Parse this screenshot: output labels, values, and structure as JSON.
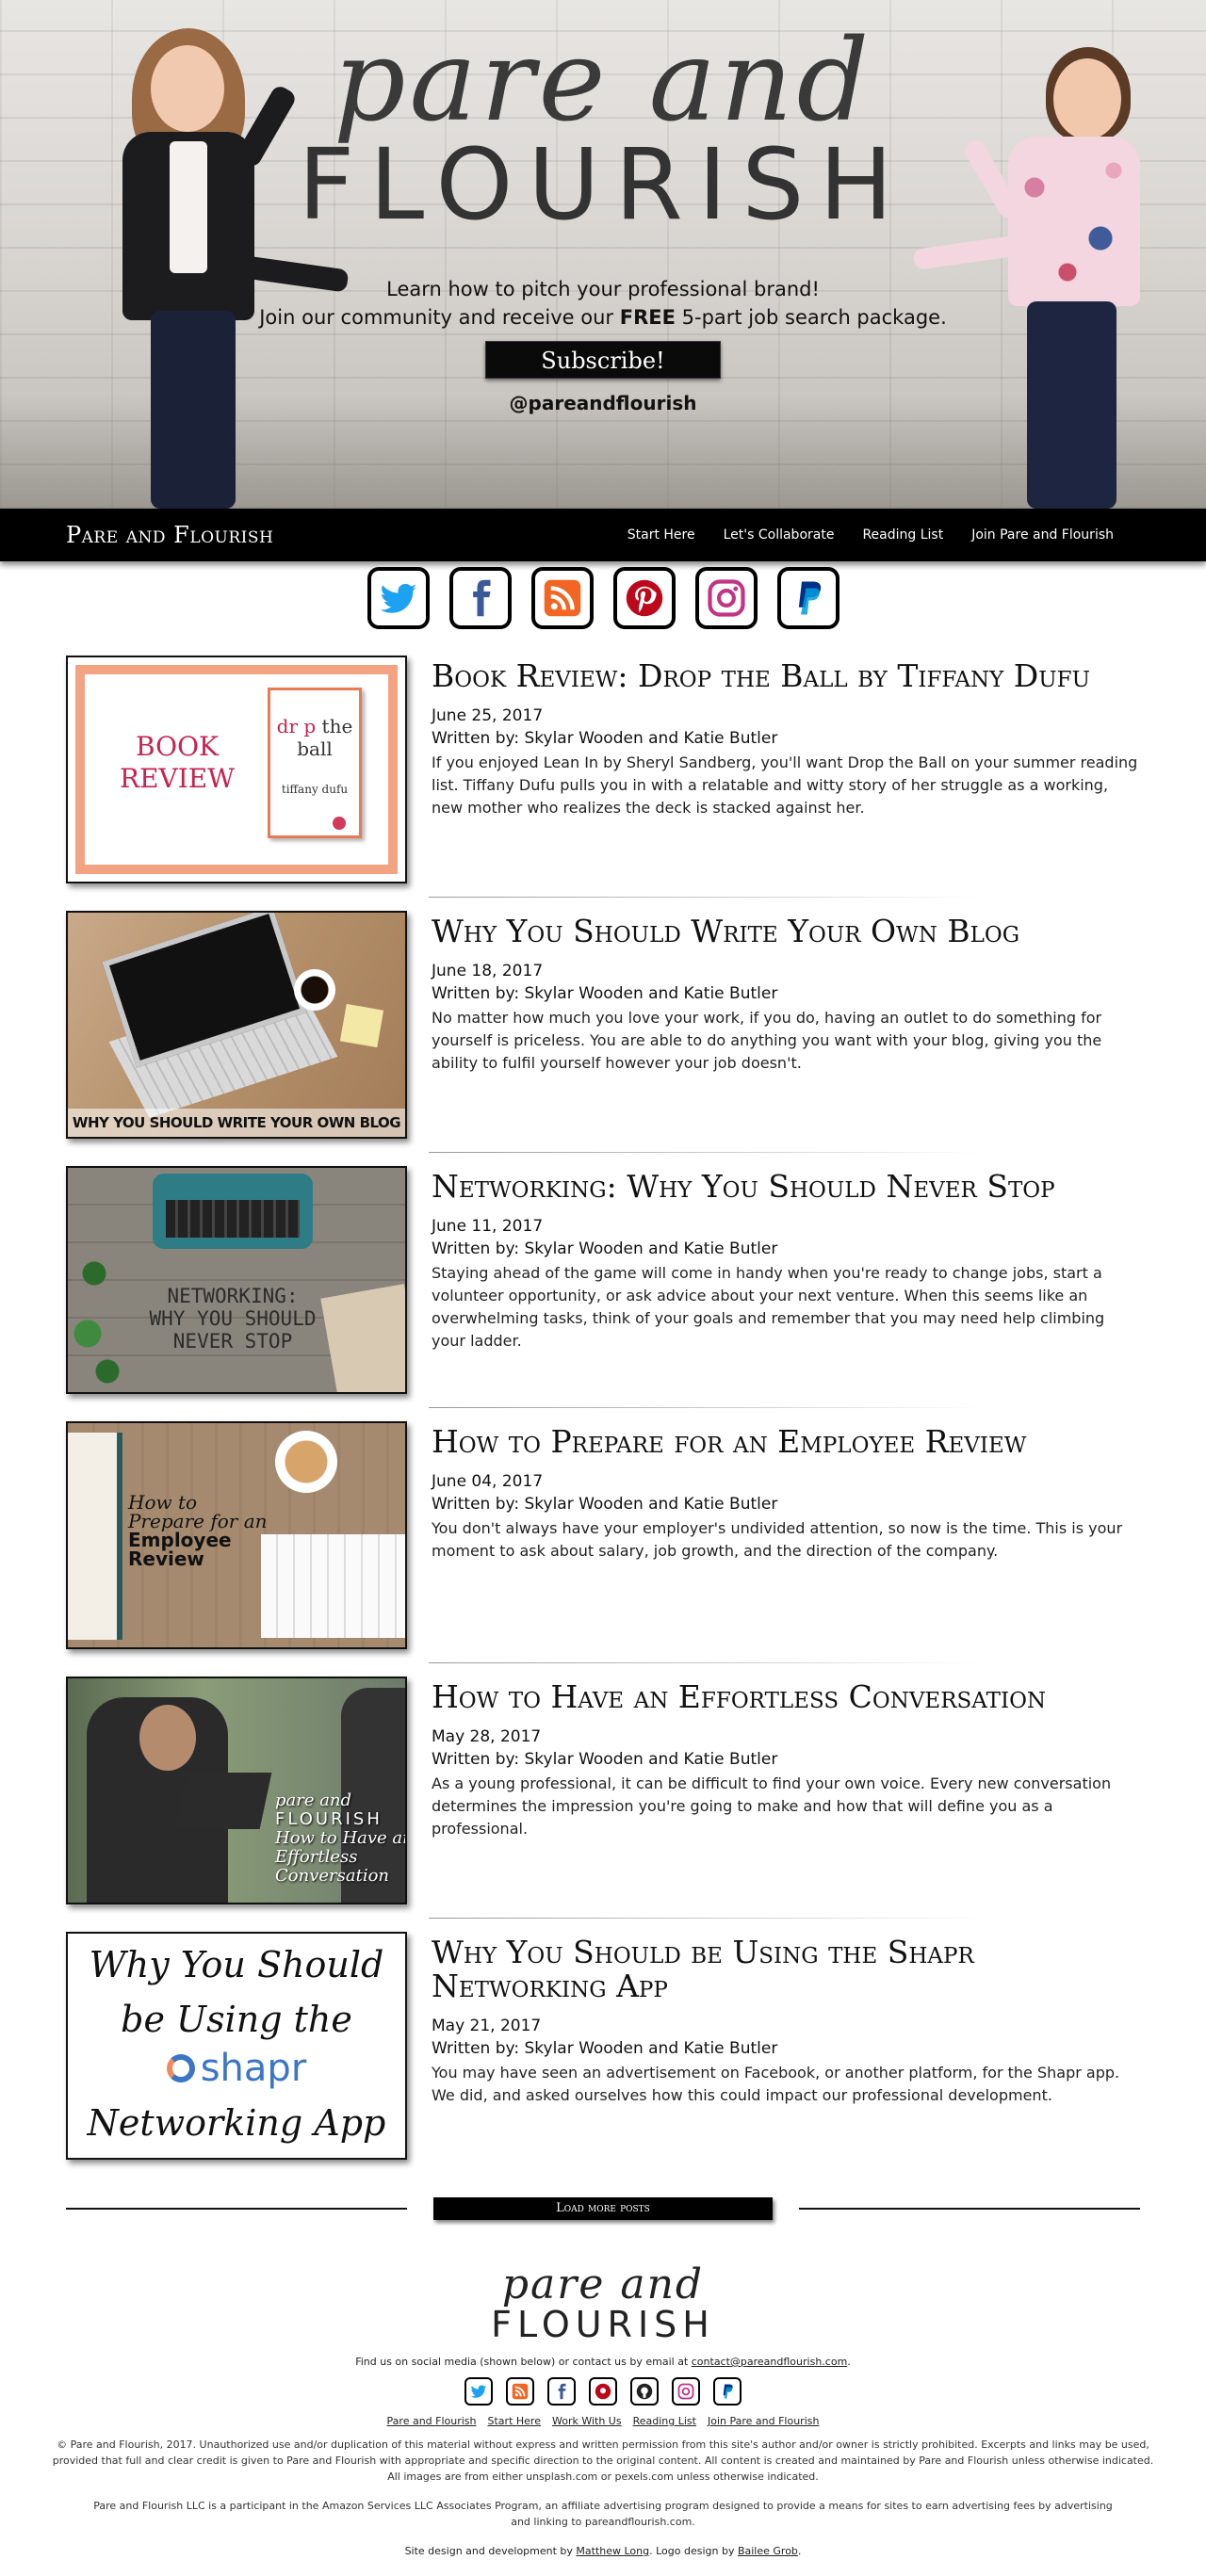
{
  "hero": {
    "script_title": "pare and",
    "main_title": "FLOURISH",
    "tagline_1": "Learn how to pitch your professional brand!",
    "tagline_2a": "Join our community and receive our ",
    "tagline_2b": "FREE",
    "tagline_2c": " 5-part job search package.",
    "subscribe_label": "Subscribe!",
    "handle": "@pareandflourish"
  },
  "nav": {
    "brand": "Pare and Flourish",
    "links": [
      "Start Here",
      "Let's Collaborate",
      "Reading List",
      "Join Pare and Flourish"
    ]
  },
  "social": {
    "icons": [
      "twitter-icon",
      "facebook-icon",
      "rss-icon",
      "pinterest-icon",
      "instagram-icon",
      "paypal-icon"
    ],
    "colors": {
      "twitter": "#1da1f2",
      "facebook": "#3b5998",
      "rss": "#f26522",
      "pinterest": "#bd081c",
      "instagram": "#c13584",
      "paypal": "#009cde",
      "github": "#222222"
    }
  },
  "posts": [
    {
      "title": "Book Review: Drop the Ball by Tiffany Dufu",
      "date": "June 25, 2017",
      "author": "Written by: Skylar Wooden and Katie Butler",
      "excerpt": "If you enjoyed Lean In by Sheryl Sandberg, you'll want Drop the Ball on your summer reading list. Tiffany Dufu pulls you in with a relatable and witty story of her struggle as a working, new mother who realizes the deck is stacked against her.",
      "thumb": {
        "label_line1": "BOOK",
        "label_line2": "REVIEW",
        "book_title_a": "dr",
        "book_title_b": "p",
        "book_title_c": " the",
        "book_title_d": "ball",
        "book_author": "tiffany dufu"
      }
    },
    {
      "title": "Why You Should Write Your Own Blog",
      "date": "June 18, 2017",
      "author": "Written by: Skylar Wooden and Katie Butler",
      "excerpt": "No matter how much you love your work, if you do, having an outlet to do something for yourself is priceless. You are able to do anything you want with your blog, giving you the ability to fulfil yourself however your job doesn't.",
      "thumb": {
        "caption": "WHY YOU SHOULD WRITE YOUR OWN BLOG"
      }
    },
    {
      "title": "Networking: Why You Should Never Stop",
      "date": "June 11, 2017",
      "author": "Written by: Skylar Wooden and Katie Butler",
      "excerpt": "Staying ahead of the game will come in handy when you're ready to change jobs, start a volunteer opportunity, or ask advice about your next venture. When this seems like an overwhelming tasks, think of your goals and remember that you may need help climbing your ladder.",
      "thumb": {
        "line1": "NETWORKING:",
        "line2": "WHY YOU SHOULD",
        "line3": "NEVER STOP"
      }
    },
    {
      "title": "How to Prepare for an Employee Review",
      "date": "June 04, 2017",
      "author": "Written by: Skylar Wooden and Katie Butler",
      "excerpt": "You don't always have your employer's undivided attention, so now is the time. This is your moment to ask about salary, job growth, and the direction of the company.",
      "thumb": {
        "line1": "How to",
        "line2": "Prepare for an",
        "line3": "Employee",
        "line4": "Review"
      }
    },
    {
      "title": "How to Have an Effortless Conversation",
      "date": "May 28, 2017",
      "author": "Written by: Skylar Wooden and Katie Butler",
      "excerpt": "As a young professional, it can be difficult to find your own voice. Every new conversation determines the impression you're going to make and how that will define you as a professional.",
      "thumb": {
        "line1": "pare and",
        "line2": "FLOURISH",
        "line3": "How to Have an",
        "line4": "Effortless Conversation"
      }
    },
    {
      "title": "Why You Should be Using the Shapr Networking App",
      "date": "May 21, 2017",
      "author": "Written by: Skylar Wooden and Katie Butler",
      "excerpt": "You may have seen an advertisement on Facebook, or another platform, for the Shapr app. We did, and asked ourselves how this could impact our professional development.",
      "thumb": {
        "line1": "Why You Should",
        "line2": "be Using the",
        "brand": "shapr",
        "line3": "Networking App"
      }
    }
  ],
  "load_more": "Load more posts",
  "footer": {
    "logo_script": "pare and",
    "logo_main": "FLOURISH",
    "find_text": "Find us on social media (shown below) or contact us by email at ",
    "email": "contact@pareandflourish.com",
    "find_end": ".",
    "icons": [
      "twitter-icon",
      "rss-icon",
      "facebook-icon",
      "pinterest-icon",
      "github-icon",
      "instagram-icon",
      "paypal-icon"
    ],
    "links": [
      "Pare and Flourish",
      "Start Here",
      "Work With Us",
      "Reading List",
      "Join Pare and Flourish"
    ],
    "legal": "© Pare and Flourish, 2017. Unauthorized use and/or duplication of this material without express and written permission from this site's author and/or owner is strictly prohibited. Excerpts and links may be used, provided that full and clear credit is given to Pare and Flourish with appropriate and specific direction to the original content. All content is created and maintained by Pare and Flourish unless otherwise indicated. All images are from either unsplash.com or pexels.com unless otherwise indicated.",
    "amazon": "Pare and Flourish LLC is a participant in the Amazon Services LLC Associates Program, an affiliate advertising program designed to provide a means for sites to earn advertising fees by advertising and linking to pareandflourish.com.",
    "credit_a": "Site design and development by ",
    "credit_dev": "Matthew Long",
    "credit_b": ". Logo design by ",
    "credit_logo": "Bailee Grob",
    "credit_c": "."
  }
}
